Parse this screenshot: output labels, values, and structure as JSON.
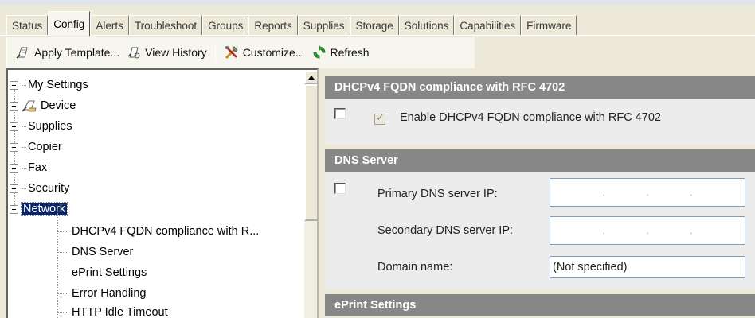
{
  "tabs": [
    {
      "label": "Status",
      "active": false
    },
    {
      "label": "Config",
      "active": true
    },
    {
      "label": "Alerts",
      "active": false
    },
    {
      "label": "Troubleshoot",
      "active": false
    },
    {
      "label": "Groups",
      "active": false
    },
    {
      "label": "Reports",
      "active": false
    },
    {
      "label": "Supplies",
      "active": false
    },
    {
      "label": "Storage",
      "active": false
    },
    {
      "label": "Solutions",
      "active": false
    },
    {
      "label": "Capabilities",
      "active": false
    },
    {
      "label": "Firmware",
      "active": false
    }
  ],
  "toolbar": {
    "apply_template": "Apply Template...",
    "view_history": "View History",
    "customize": "Customize...",
    "refresh": "Refresh"
  },
  "tree": {
    "items": [
      {
        "label": "My Settings"
      },
      {
        "label": "Device"
      },
      {
        "label": "Supplies"
      },
      {
        "label": "Copier"
      },
      {
        "label": "Fax"
      },
      {
        "label": "Security"
      },
      {
        "label": "Network"
      }
    ],
    "children": [
      {
        "label": "DHCPv4 FQDN compliance with R..."
      },
      {
        "label": "DNS Server"
      },
      {
        "label": "ePrint Settings"
      },
      {
        "label": "Error Handling"
      },
      {
        "label": "HTTP Idle Timeout"
      }
    ]
  },
  "panel": {
    "dhcp_title": "DHCPv4 FQDN compliance with RFC 4702",
    "dhcp_checkbox_label": "Enable DHCPv4 FQDN compliance with RFC 4702",
    "dns_title": "DNS Server",
    "primary_dns_label": "Primary DNS server IP:",
    "secondary_dns_label": "Secondary DNS server IP:",
    "domain_label": "Domain name:",
    "domain_value": "(Not specified)",
    "eprint_title": "ePrint Settings"
  },
  "colors": {
    "selection": "#0a246a",
    "section_header": "#878787"
  }
}
